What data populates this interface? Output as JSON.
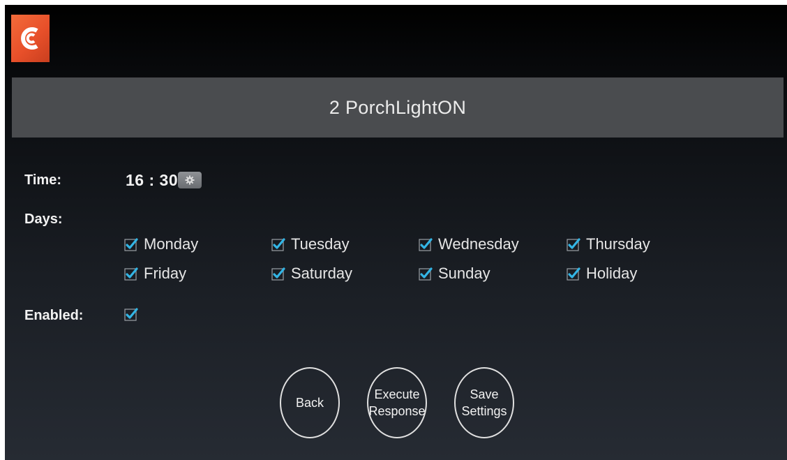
{
  "app": {
    "logo_icon": "app-logo-icon",
    "logo_color": "#e8502a"
  },
  "header": {
    "title": "2  PorchLightON"
  },
  "schedule": {
    "time_label": "Time:",
    "time_value": "16 : 30",
    "time_button_icon": "gear-icon",
    "days_label": "Days:",
    "enabled_label": "Enabled:",
    "enabled_checked": true,
    "check_color": "#33b5e5",
    "days": [
      {
        "label": "Monday",
        "checked": true
      },
      {
        "label": "Tuesday",
        "checked": true
      },
      {
        "label": "Wednesday",
        "checked": true
      },
      {
        "label": "Thursday",
        "checked": true
      },
      {
        "label": "Friday",
        "checked": true
      },
      {
        "label": "Saturday",
        "checked": true
      },
      {
        "label": "Sunday",
        "checked": true
      },
      {
        "label": "Holiday",
        "checked": true
      }
    ]
  },
  "actions": {
    "back": "Back",
    "execute_line1": "Execute",
    "execute_line2": "Response",
    "save_line1": "Save",
    "save_line2": "Settings"
  }
}
